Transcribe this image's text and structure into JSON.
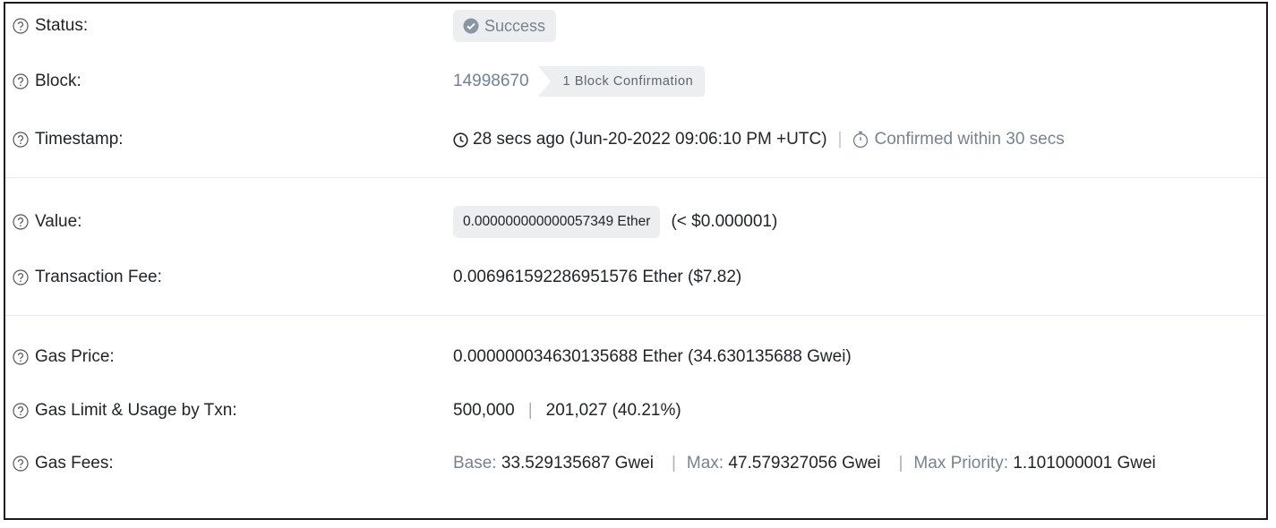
{
  "rows": {
    "status": {
      "label": "Status:",
      "value": "Success"
    },
    "block": {
      "label": "Block:",
      "number": "14998670",
      "confirmation": "1 Block Confirmation"
    },
    "timestamp": {
      "label": "Timestamp:",
      "value": "28 secs ago (Jun-20-2022 09:06:10 PM +UTC)",
      "separator": "|",
      "confirmed": "Confirmed within 30 secs"
    },
    "value": {
      "label": "Value:",
      "amount": "0.000000000000057349 Ether",
      "usd": "(< $0.000001)"
    },
    "transaction_fee": {
      "label": "Transaction Fee:",
      "value": "0.006961592286951576 Ether ($7.82)"
    },
    "gas_price": {
      "label": "Gas Price:",
      "value": "0.000000034630135688 Ether (34.630135688 Gwei)"
    },
    "gas_limit": {
      "label": "Gas Limit & Usage by Txn:",
      "limit": "500,000",
      "separator": "|",
      "usage": "201,027 (40.21%)"
    },
    "gas_fees": {
      "label": "Gas Fees:",
      "base_label": "Base:",
      "base_value": "33.529135687 Gwei",
      "separator": "|",
      "max_label": "Max:",
      "max_value": "47.579327056 Gwei",
      "priority_label": "Max Priority:",
      "priority_value": "1.101000001 Gwei"
    }
  },
  "colors": {
    "text": "#212529",
    "muted": "#77838f",
    "link": "#6c8399",
    "badge_bg": "#eceef0",
    "divider": "#e7eaf3"
  },
  "icons": {
    "help": "question-circle-icon",
    "success": "check-circle-icon",
    "clock": "clock-icon",
    "timer": "stopwatch-icon"
  }
}
